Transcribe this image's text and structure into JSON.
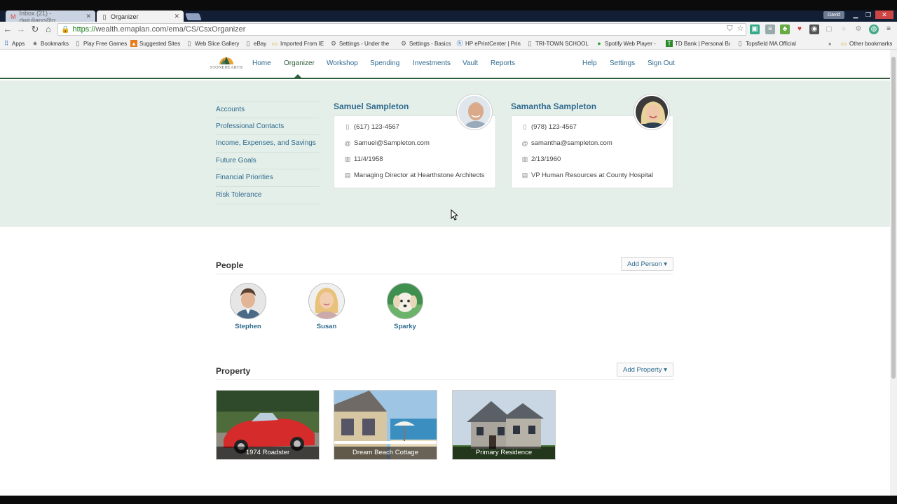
{
  "browser": {
    "tabs": [
      {
        "title": "Inbox (21) - dwjuliano@g",
        "favicon": "gmail-icon",
        "active": false
      },
      {
        "title": "Organizer",
        "favicon": "page-icon",
        "active": true
      }
    ],
    "profile_name": "David",
    "url_https": "https://",
    "url_rest": "wealth.emaplan.com/ema/CS/CsxOrganizer",
    "bookmarks": [
      {
        "label": "Apps",
        "icon": "apps-grid-icon"
      },
      {
        "label": "Bookmarks",
        "icon": "star-icon"
      },
      {
        "label": "Play Free Games",
        "icon": "page-icon"
      },
      {
        "label": "Suggested Sites",
        "icon": "suggested-sites-icon"
      },
      {
        "label": "Web Slice Gallery",
        "icon": "page-icon"
      },
      {
        "label": "eBay",
        "icon": "page-icon"
      },
      {
        "label": "Imported From IE",
        "icon": "folder-icon"
      },
      {
        "label": "Settings - Under the",
        "icon": "gear-icon"
      },
      {
        "label": "Settings - Basics",
        "icon": "gear-icon"
      },
      {
        "label": "HP ePrintCenter | Prin",
        "icon": "hp-icon"
      },
      {
        "label": "TRI-TOWN SCHOOL",
        "icon": "page-icon"
      },
      {
        "label": "Spotify Web Player -",
        "icon": "spotify-icon"
      },
      {
        "label": "TD Bank | Personal Ba",
        "icon": "td-bank-icon"
      },
      {
        "label": "Topsfield MA Official",
        "icon": "page-icon"
      },
      {
        "label": "»",
        "icon": ""
      },
      {
        "label": "Other bookmarks",
        "icon": "folder-icon"
      }
    ]
  },
  "app": {
    "logo_text": "STONEHEARTH",
    "nav": [
      {
        "label": "Home",
        "active": false
      },
      {
        "label": "Organizer",
        "active": true
      },
      {
        "label": "Workshop",
        "active": false
      },
      {
        "label": "Spending",
        "active": false
      },
      {
        "label": "Investments",
        "active": false
      },
      {
        "label": "Vault",
        "active": false
      },
      {
        "label": "Reports",
        "active": false
      }
    ],
    "nav_right": [
      "Help",
      "Settings",
      "Sign Out"
    ]
  },
  "side_menu": [
    "Accounts",
    "Professional Contacts",
    "Income, Expenses, and Savings",
    "Future Goals",
    "Financial Priorities",
    "Risk Tolerance"
  ],
  "clients": [
    {
      "name": "Samuel Sampleton",
      "phone": "(617) 123-4567",
      "email": "Samuel@Sampleton.com",
      "dob": "11/4/1958",
      "job": "Managing Director at Hearthstone Architects"
    },
    {
      "name": "Samantha Sampleton",
      "phone": "(978) 123-4567",
      "email": "samantha@sampleton.com",
      "dob": "2/13/1960",
      "job": "VP Human Resources at County Hospital"
    }
  ],
  "people_section": {
    "title": "People",
    "add_label": "Add Person",
    "people": [
      "Stephen",
      "Susan",
      "Sparky"
    ]
  },
  "property_section": {
    "title": "Property",
    "add_label": "Add Property",
    "items": [
      "1974 Roadster",
      "Dream Beach Cottage",
      "Primary Residence"
    ]
  },
  "colors": {
    "link": "#2e6a8e",
    "brand_green": "#2e5e3a",
    "band_bg": "#e5efe9"
  }
}
